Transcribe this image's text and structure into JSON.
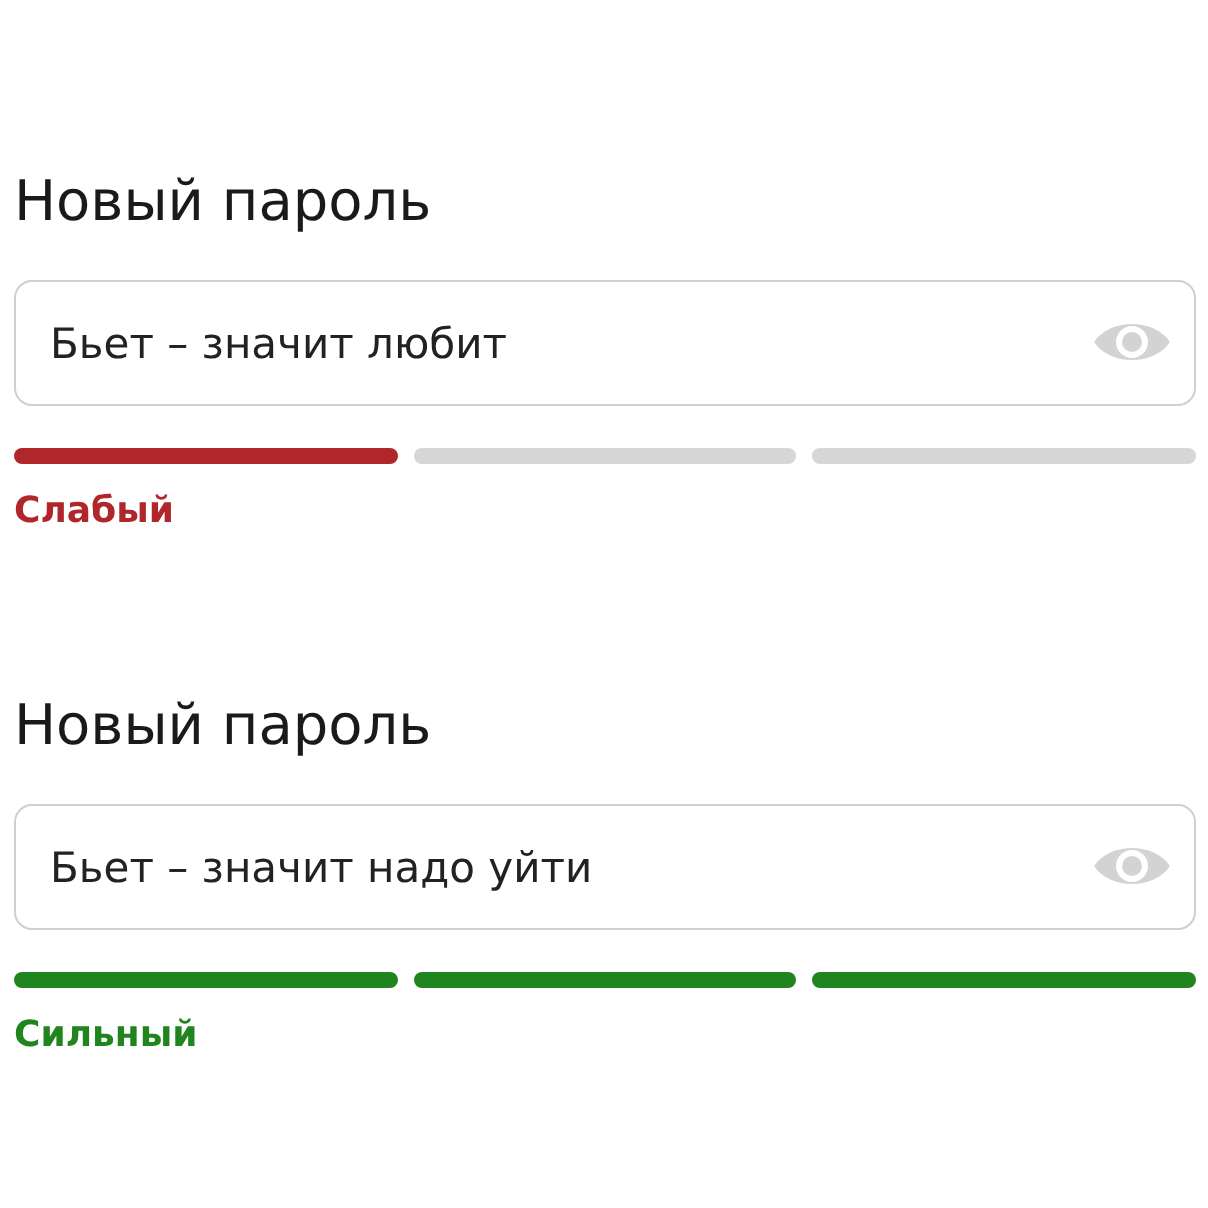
{
  "password_fields": [
    {
      "label": "Новый пароль",
      "value": "Бьет – значит любит",
      "strength": {
        "kind": "weak",
        "text": "Слабый",
        "segments": [
          {
            "on": true
          },
          {
            "on": false
          },
          {
            "on": false
          }
        ]
      }
    },
    {
      "label": "Новый пароль",
      "value": "Бьет – значит надо уйти",
      "strength": {
        "kind": "strong",
        "text": "Сильный",
        "segments": [
          {
            "on": true
          },
          {
            "on": true
          },
          {
            "on": true
          }
        ]
      }
    }
  ]
}
